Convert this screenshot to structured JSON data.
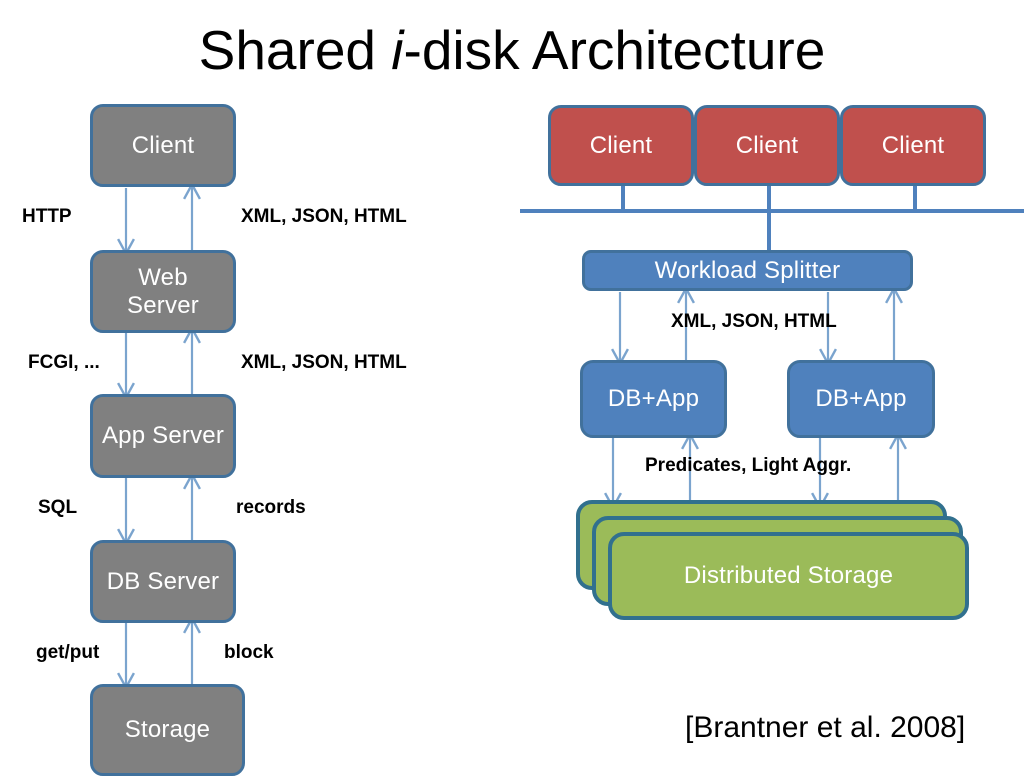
{
  "title": {
    "prefix": "Shared ",
    "italic": "i",
    "suffix": "-disk Architecture"
  },
  "colors": {
    "gray": "#808080",
    "red": "#C0504D",
    "blue": "#4F81BD",
    "green": "#9BBB59",
    "border": "#41719C",
    "green_border": "#31708E",
    "arrow": "#7BA4CE",
    "text_on_box": "#FFFFFF",
    "label_text": "#000000"
  },
  "left_diagram": {
    "name": "classic-stack",
    "nodes": [
      {
        "id": "client",
        "label": "Client"
      },
      {
        "id": "web-server",
        "label": "Web\nServer",
        "line1": "Web",
        "line2": "Server"
      },
      {
        "id": "app-server",
        "label": "App Server"
      },
      {
        "id": "db-server",
        "label": "DB Server"
      },
      {
        "id": "storage",
        "label": "Storage"
      }
    ],
    "edge_labels": [
      {
        "id": "http",
        "text": "HTTP"
      },
      {
        "id": "xml-json-html-1",
        "text": "XML, JSON, HTML"
      },
      {
        "id": "fcgi",
        "text": "FCGI, ..."
      },
      {
        "id": "xml-json-html-2",
        "text": "XML, JSON, HTML"
      },
      {
        "id": "sql",
        "text": "SQL"
      },
      {
        "id": "records",
        "text": "records"
      },
      {
        "id": "get-put",
        "text": "get/put"
      },
      {
        "id": "block",
        "text": "block"
      }
    ]
  },
  "right_diagram": {
    "name": "shared-i-disk-stack",
    "clients": [
      {
        "id": "client-1",
        "label": "Client"
      },
      {
        "id": "client-2",
        "label": "Client"
      },
      {
        "id": "client-3",
        "label": "Client"
      }
    ],
    "splitter": {
      "id": "workload-splitter",
      "label": "Workload Splitter"
    },
    "db_apps": [
      {
        "id": "db-app-1",
        "label": "DB+App"
      },
      {
        "id": "db-app-2",
        "label": "DB+App"
      }
    ],
    "storage": {
      "id": "distributed-storage",
      "label": "Distributed Storage",
      "stack_count": 3
    },
    "edge_labels": [
      {
        "id": "xml-json-html-3",
        "text": "XML, JSON, HTML"
      },
      {
        "id": "predicates",
        "text": "Predicates, Light Aggr."
      }
    ]
  },
  "citation": "[Brantner et al. 2008]"
}
